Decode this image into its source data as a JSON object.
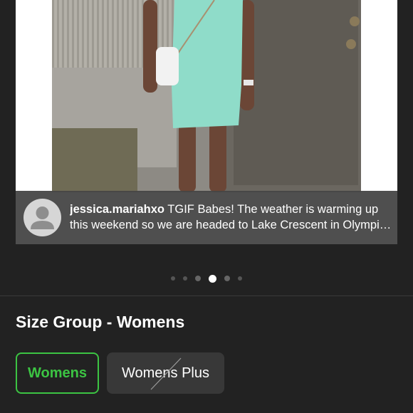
{
  "post": {
    "username": "jessica.mariahxo",
    "caption_line1": "TGIF Babes! The weather is warming up",
    "caption_line2": "this weekend so we are headed to Lake Crescent in Olympi…"
  },
  "carousel": {
    "total_images": 6,
    "active_index": 3
  },
  "size_group": {
    "heading": "Size Group - Womens",
    "options": [
      {
        "label": "Womens",
        "state": "selected"
      },
      {
        "label": "Womens Plus",
        "state": "unavailable"
      }
    ]
  },
  "colors": {
    "background": "#222222",
    "selected_green": "#3cc443"
  }
}
